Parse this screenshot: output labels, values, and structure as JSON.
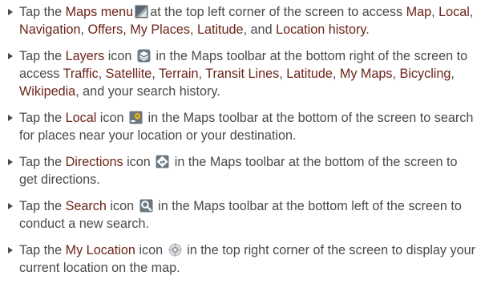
{
  "items": [
    {
      "icon": "maps-menu-icon",
      "parts": [
        {
          "t": "Tap the ",
          "hl": false
        },
        {
          "t": "Maps menu",
          "hl": true
        },
        {
          "icon": "maps-menu-icon"
        },
        {
          "t": "at the top left corner of the screen to access ",
          "hl": false
        },
        {
          "t": "Map",
          "hl": true
        },
        {
          "t": ", ",
          "hl": false
        },
        {
          "t": "Local",
          "hl": true
        },
        {
          "t": ", ",
          "hl": false
        },
        {
          "t": "Navigation",
          "hl": true
        },
        {
          "t": ", ",
          "hl": false
        },
        {
          "t": "Offers,",
          "hl": true
        },
        {
          "t": " ",
          "hl": false
        },
        {
          "t": "My Places",
          "hl": true
        },
        {
          "t": ", ",
          "hl": false
        },
        {
          "t": "Latitude",
          "hl": true
        },
        {
          "t": ", and ",
          "hl": false
        },
        {
          "t": "Location history",
          "hl": true
        },
        {
          "t": ".",
          "hl": false
        }
      ]
    },
    {
      "icon": "layers-icon",
      "parts": [
        {
          "t": "Tap the ",
          "hl": false
        },
        {
          "t": "Layers",
          "hl": true
        },
        {
          "t": " icon ",
          "hl": false
        },
        {
          "icon": "layers-icon"
        },
        {
          "t": " in the Maps toolbar at the bottom right of the screen to access ",
          "hl": false
        },
        {
          "t": "Traffic",
          "hl": true
        },
        {
          "t": ", ",
          "hl": false
        },
        {
          "t": "Satellite",
          "hl": true
        },
        {
          "t": ", ",
          "hl": false
        },
        {
          "t": "Terrain",
          "hl": true
        },
        {
          "t": ", ",
          "hl": false
        },
        {
          "t": "Transit Lines",
          "hl": true
        },
        {
          "t": ", ",
          "hl": false
        },
        {
          "t": "Latitude",
          "hl": true
        },
        {
          "t": ", ",
          "hl": false
        },
        {
          "t": "My Maps",
          "hl": true
        },
        {
          "t": ", ",
          "hl": false
        },
        {
          "t": "Bicycling",
          "hl": true
        },
        {
          "t": ", ",
          "hl": false
        },
        {
          "t": "Wikipedia",
          "hl": true
        },
        {
          "t": ", and your search history.",
          "hl": false
        }
      ]
    },
    {
      "icon": "local-icon",
      "parts": [
        {
          "t": "Tap the ",
          "hl": false
        },
        {
          "t": "Local",
          "hl": true
        },
        {
          "t": " icon ",
          "hl": false
        },
        {
          "icon": "local-icon"
        },
        {
          "t": " in the Maps toolbar at the bottom of the screen to search for places near your location or your destination.",
          "hl": false
        }
      ]
    },
    {
      "icon": "directions-icon",
      "parts": [
        {
          "t": "Tap the ",
          "hl": false
        },
        {
          "t": "Directions",
          "hl": true
        },
        {
          "t": " icon ",
          "hl": false
        },
        {
          "icon": "directions-icon"
        },
        {
          "t": " in the Maps toolbar at the bottom of the screen to get directions.",
          "hl": false
        }
      ]
    },
    {
      "icon": "search-icon",
      "parts": [
        {
          "t": "Tap the ",
          "hl": false
        },
        {
          "t": "Search",
          "hl": true
        },
        {
          "t": " icon ",
          "hl": false
        },
        {
          "icon": "search-icon"
        },
        {
          "t": " in the Maps toolbar at the bottom left of the screen to conduct a new search.",
          "hl": false
        }
      ]
    },
    {
      "icon": "my-location-icon",
      "parts": [
        {
          "t": "Tap the ",
          "hl": false
        },
        {
          "t": "My Location",
          "hl": true
        },
        {
          "t": " icon ",
          "hl": false
        },
        {
          "icon": "my-location-icon"
        },
        {
          "t": " in the top right corner of the screen to display your current location on the map.",
          "hl": false
        }
      ]
    }
  ],
  "colors": {
    "body_text": "#4a4a4a",
    "highlight_text": "#6b2418"
  }
}
